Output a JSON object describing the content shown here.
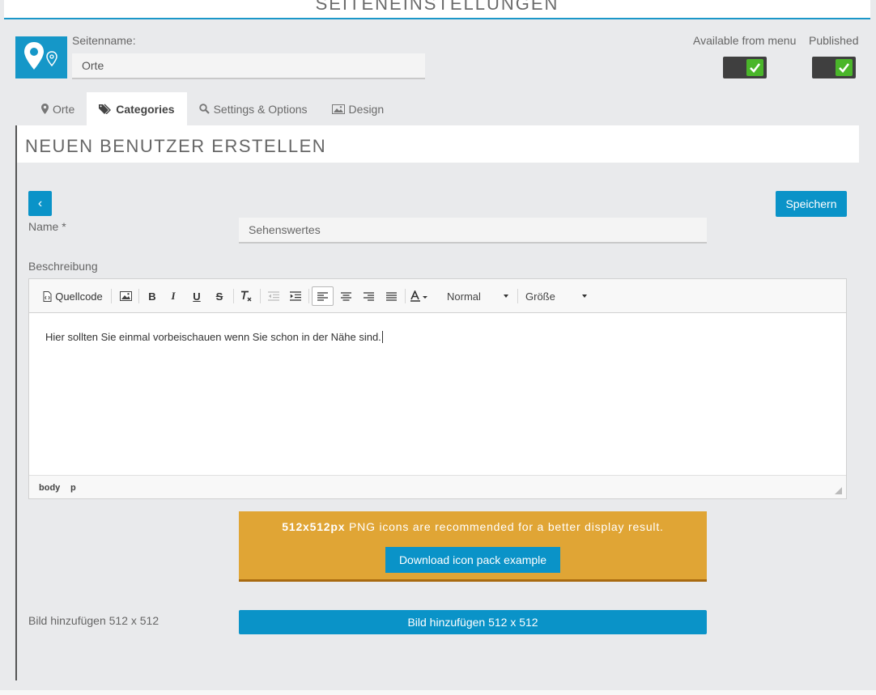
{
  "page_header": {
    "title": "Seiteneinstellungen"
  },
  "page_name": {
    "label": "Seitenname:",
    "value": "Orte"
  },
  "toggles": [
    {
      "label": "Available from menu",
      "checked": true
    },
    {
      "label": "Published",
      "checked": true
    }
  ],
  "tabs": [
    {
      "label": "Orte",
      "icon": "map-marker-icon",
      "active": false
    },
    {
      "label": "Categories",
      "icon": "tags-icon",
      "active": true
    },
    {
      "label": "Settings & Options",
      "icon": "search-icon",
      "active": false
    },
    {
      "label": "Design",
      "icon": "image-icon",
      "active": false
    }
  ],
  "section": {
    "title": "Neuen Benutzer erstellen"
  },
  "actions": {
    "back": "‹",
    "save": "Speichern"
  },
  "form": {
    "name_label": "Name *",
    "name_value": "Sehenswertes",
    "description_label": "Beschreibung"
  },
  "editor": {
    "source_label": "Quellcode",
    "format_value": "Normal",
    "size_value": "Größe",
    "content": "Hier sollten Sie einmal vorbeischauen wenn Sie schon in der Nähe sind.",
    "path": [
      "body",
      "p"
    ]
  },
  "notice": {
    "bold": "512x512px",
    "text": " PNG icons are recommended for a better display result.",
    "button": "Download icon pack example"
  },
  "image": {
    "label": "Bild hinzufügen 512 x 512",
    "button": "Bild hinzufügen 512 x 512"
  },
  "colors": {
    "accent": "#0a93c8",
    "notice": "#e0a535",
    "toggle_on": "#4ab62a"
  }
}
